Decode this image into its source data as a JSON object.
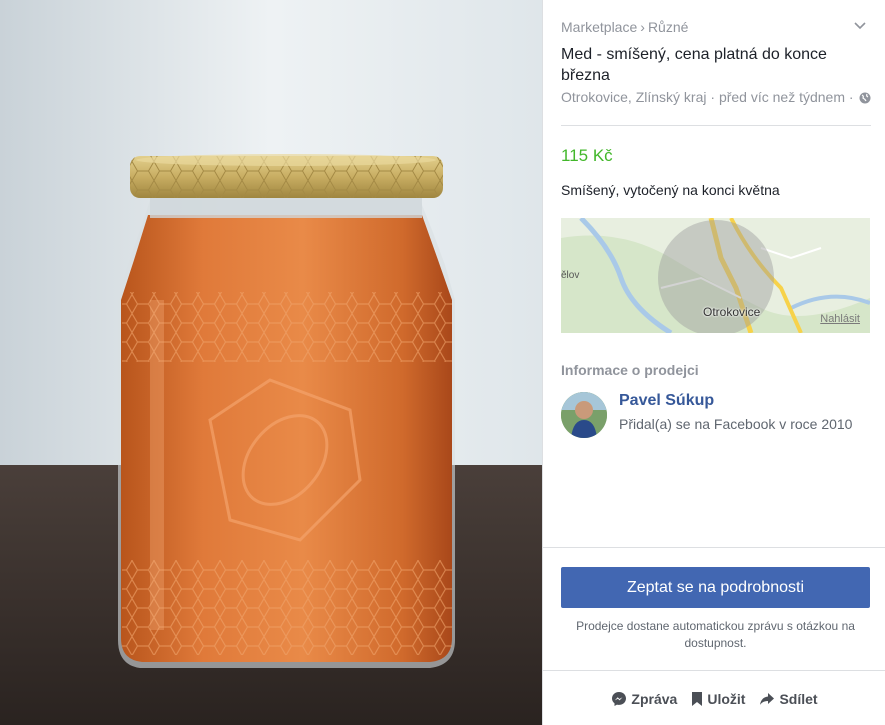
{
  "breadcrumb": {
    "root": "Marketplace",
    "separator": "›",
    "category": "Různé"
  },
  "listing": {
    "title": "Med - smíšený, cena platná do konce března",
    "location": "Otrokovice, Zlínský kraj",
    "time": "před víc než týdnem",
    "meta_separator": "·",
    "price": "115 Kč",
    "description": "Smíšený, vytočený na konci května"
  },
  "map": {
    "place_label": "Otrokovice",
    "left_label": "ělov",
    "report_label": "Nahlásit"
  },
  "seller": {
    "section_title": "Informace o prodejci",
    "name": "Pavel Súkup",
    "joined": "Přidal(a) se na Facebook v roce 2010"
  },
  "cta": {
    "ask_label": "Zeptat se na podrobnosti",
    "note": "Prodejce dostane automatickou zprávu s otázkou na dostupnost."
  },
  "actions": {
    "message": "Zpráva",
    "save": "Uložit",
    "share": "Sdílet"
  },
  "colors": {
    "price": "#42b72a",
    "button": "#4267b2",
    "seller_name": "#365899"
  },
  "icons": [
    "chevron-down-icon",
    "globe-icon",
    "messenger-icon",
    "bookmark-icon",
    "share-arrow-icon"
  ]
}
